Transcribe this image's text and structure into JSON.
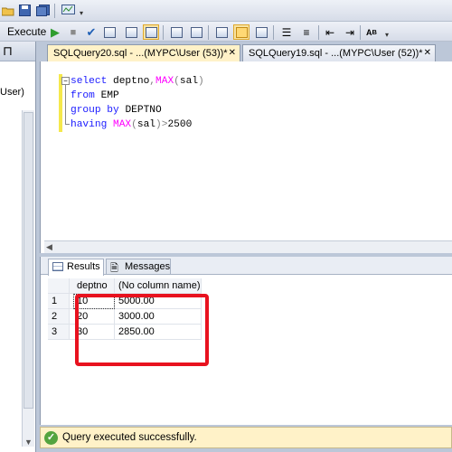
{
  "toolbar": {
    "execute_label": "Execute"
  },
  "explorer": {
    "pin_glyph": "□",
    "tree_item_text": "User)"
  },
  "tabs": [
    {
      "label": "SQLQuery20.sql - ...(MYPC\\User (53))*",
      "close": "✕",
      "active": true
    },
    {
      "label": "SQLQuery19.sql - ...(MYPC\\User (52))*",
      "close": "✕",
      "active": false
    }
  ],
  "editor": {
    "lines": [
      [
        {
          "t": "select ",
          "c": "kw"
        },
        {
          "t": "deptno",
          "c": "tx"
        },
        {
          "t": ",",
          "c": "op"
        },
        {
          "t": "MAX",
          "c": "fn"
        },
        {
          "t": "(",
          "c": "op"
        },
        {
          "t": "sal",
          "c": "tx"
        },
        {
          "t": ")",
          "c": "op"
        }
      ],
      [
        {
          "t": "from ",
          "c": "kw"
        },
        {
          "t": "EMP",
          "c": "tx"
        }
      ],
      [
        {
          "t": "group by ",
          "c": "kw"
        },
        {
          "t": "DEPTNO",
          "c": "tx"
        }
      ],
      [
        {
          "t": "having ",
          "c": "kw"
        },
        {
          "t": "MAX",
          "c": "fn"
        },
        {
          "t": "(",
          "c": "op"
        },
        {
          "t": "sal",
          "c": "tx"
        },
        {
          "t": ")",
          "c": "op"
        },
        {
          "t": ">",
          "c": "op"
        },
        {
          "t": "2500",
          "c": "tx"
        }
      ]
    ]
  },
  "results": {
    "tab_results": "Results",
    "tab_messages": "Messages",
    "columns": [
      "deptno",
      "(No column name)"
    ],
    "rows": [
      {
        "num": "1",
        "deptno": "10",
        "value": "5000.00"
      },
      {
        "num": "2",
        "deptno": "20",
        "value": "3000.00"
      },
      {
        "num": "3",
        "deptno": "30",
        "value": "2850.00"
      }
    ]
  },
  "status": {
    "icon": "✓",
    "text": "Query executed successfully."
  },
  "colors": {
    "keyword": "#1a1aff",
    "function": "#ff00ff",
    "operator": "#808080",
    "highlight_box": "#e8121f",
    "status_bar": "#fff2c8",
    "active_tab": "#fff2c8"
  }
}
